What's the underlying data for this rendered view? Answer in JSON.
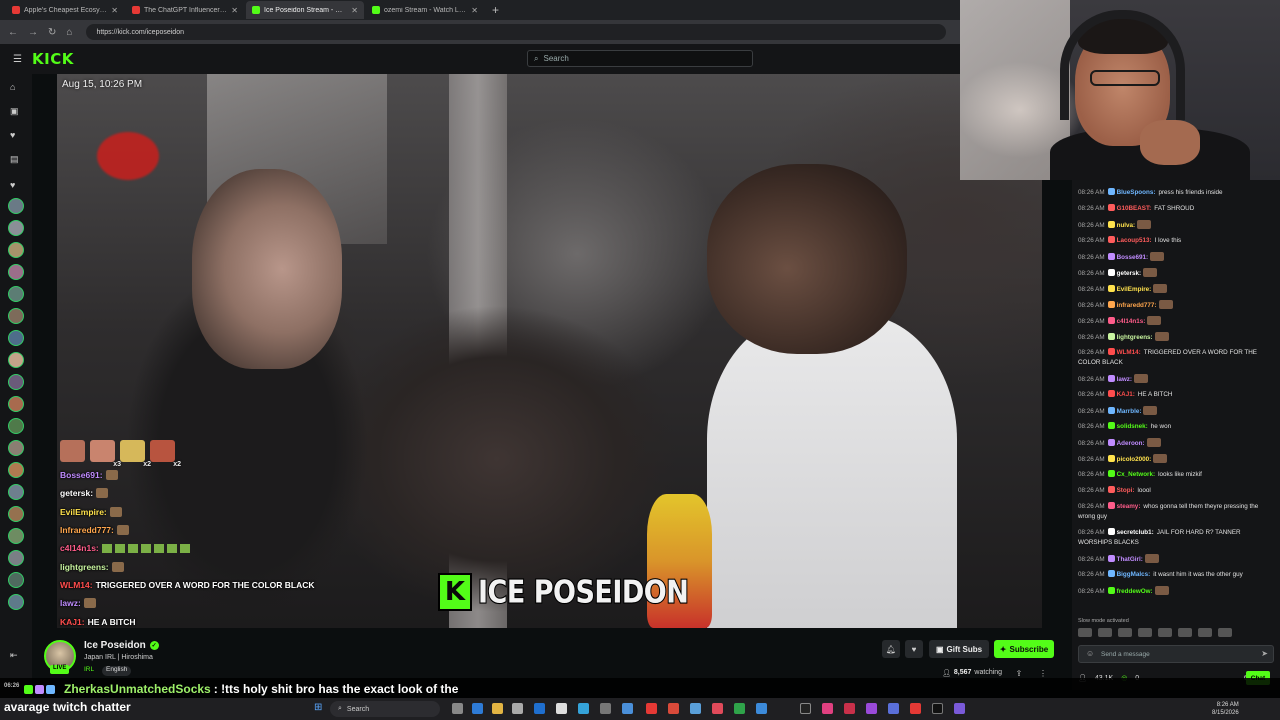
{
  "browser": {
    "tabs": [
      {
        "label": "Apple's Cheapest Ecosystem Brought",
        "favicon_color": "#e53935",
        "active": false
      },
      {
        "label": "The ChatGPT Influencer Trip Just H",
        "favicon_color": "#e53935",
        "active": false
      },
      {
        "label": "Ice Poseidon Stream - Watch",
        "favicon_color": "#53fc18",
        "active": true
      },
      {
        "label": "ozemi Stream - Watch Live on",
        "favicon_color": "#53fc18",
        "active": false
      }
    ],
    "url": "https://kick.com/iceposeidon"
  },
  "kick": {
    "logo": "KICK",
    "search_placeholder": "Search"
  },
  "video": {
    "date_overlay": "Aug 15, 10:26 PM",
    "watermark_text": "ICE POSEIDON",
    "watermark_logo": "K",
    "overlay_emote_counts": [
      "x3",
      "x2",
      "x2"
    ],
    "overlay_chat": [
      {
        "user": "Bosse691:",
        "color": "#c08cff",
        "text": "",
        "emote": true
      },
      {
        "user": "getersk:",
        "color": "#ffffff",
        "text": "",
        "emote": true
      },
      {
        "user": "EvilEmpire:",
        "color": "#ffe24d",
        "text": "",
        "emote": true
      },
      {
        "user": "Infraredd777:",
        "color": "#ffa64d",
        "text": "",
        "emote": true
      },
      {
        "user": "c4l14n1s:",
        "color": "#ff5c8a",
        "text": "",
        "frogs": true
      },
      {
        "user": "lightgreens:",
        "color": "#c9f5a0",
        "text": "",
        "emote": true
      },
      {
        "user": "WLM14:",
        "color": "#ff4d4d",
        "text": "TRIGGERED OVER A WORD FOR THE COLOR BLACK"
      },
      {
        "user": "lawz:",
        "color": "#c08cff",
        "text": "",
        "emote": true
      },
      {
        "user": "KAJ1:",
        "color": "#ff4d4d",
        "text": "HE A BITCH"
      }
    ]
  },
  "stream": {
    "streamer": "Ice Poseidon",
    "title": "Japan IRL | Hiroshima",
    "category": "IRL",
    "tag": "English",
    "live_badge": "LIVE",
    "gift_label": "Gift Subs",
    "subscribe_label": "Subscribe",
    "viewers": "8,567",
    "viewers_suffix": "watching"
  },
  "chat": {
    "messages": [
      {
        "ts": "08:26 AM",
        "user": "BlueSpoons:",
        "color": "#6fb7ff",
        "text": "press his friends inside"
      },
      {
        "ts": "08:26 AM",
        "user": "G10BEAST:",
        "color": "#ff5c5c",
        "text": "FAT SHROUD"
      },
      {
        "ts": "08:26 AM",
        "user": "nulva:",
        "color": "#ffe24d",
        "text": ""
      },
      {
        "ts": "08:26 AM",
        "user": "Lacoup513:",
        "color": "#ff5c5c",
        "text": "I love this"
      },
      {
        "ts": "08:26 AM",
        "user": "Bosse691:",
        "color": "#c08cff",
        "text": ""
      },
      {
        "ts": "08:26 AM",
        "user": "getersk:",
        "color": "#ffffff",
        "text": ""
      },
      {
        "ts": "08:26 AM",
        "user": "EvilEmpire:",
        "color": "#ffe24d",
        "text": ""
      },
      {
        "ts": "08:26 AM",
        "user": "infraredd777:",
        "color": "#ffa64d",
        "text": ""
      },
      {
        "ts": "08:26 AM",
        "user": "c4l14n1s:",
        "color": "#ff5c8a",
        "text": ""
      },
      {
        "ts": "08:26 AM",
        "user": "lightgreens:",
        "color": "#c9f5a0",
        "text": ""
      },
      {
        "ts": "08:26 AM",
        "user": "WLM14:",
        "color": "#ff4d4d",
        "text": "TRIGGERED OVER A WORD FOR THE COLOR BLACK"
      },
      {
        "ts": "08:26 AM",
        "user": "lawz:",
        "color": "#c08cff",
        "text": ""
      },
      {
        "ts": "08:26 AM",
        "user": "KAJ1:",
        "color": "#ff4d4d",
        "text": "HE A BITCH"
      },
      {
        "ts": "08:26 AM",
        "user": "Marrble:",
        "color": "#6fb7ff",
        "text": ""
      },
      {
        "ts": "08:26 AM",
        "user": "solidsnek:",
        "color": "#53fc18",
        "text": "he won"
      },
      {
        "ts": "08:26 AM",
        "user": "Aderoon:",
        "color": "#c08cff",
        "text": ""
      },
      {
        "ts": "08:26 AM",
        "user": "picolo2000:",
        "color": "#ffe24d",
        "text": ""
      },
      {
        "ts": "08:26 AM",
        "user": "Cx_Network:",
        "color": "#53fc18",
        "text": "looks like mizkif"
      },
      {
        "ts": "08:26 AM",
        "user": "Stopi:",
        "color": "#ff5c5c",
        "text": "loool"
      },
      {
        "ts": "08:26 AM",
        "user": "steamy:",
        "color": "#ff5c8a",
        "text": "whos gonna tell them theyre pressing the wrong guy"
      },
      {
        "ts": "08:26 AM",
        "user": "secretclub1:",
        "color": "#ffffff",
        "text": "JAIL FOR HARD R? TANNER WORSHIPS BLACKS"
      },
      {
        "ts": "08:26 AM",
        "user": "ThatGirl:",
        "color": "#c08cff",
        "text": ""
      },
      {
        "ts": "08:26 AM",
        "user": "BiggMalcs:",
        "color": "#6fb7ff",
        "text": "it wasnt him it was the other guy"
      },
      {
        "ts": "08:26 AM",
        "user": "freddewOw:",
        "color": "#53fc18",
        "text": ""
      }
    ],
    "slow_mode": "Slow mode activated",
    "input_placeholder": "Send a message",
    "follower_count": "43.1K",
    "points": "0",
    "chat_button": "Chat"
  },
  "tts": {
    "time": "06:26",
    "user": "ZherkasUnmatchedSocks",
    "message": ": !tts holy shit bro has the exact look of the",
    "message_cont": "avarage twitch chatter"
  },
  "taskbar": {
    "search_placeholder": "Search",
    "time": "8:26 AM",
    "date": "8/15/2026"
  }
}
